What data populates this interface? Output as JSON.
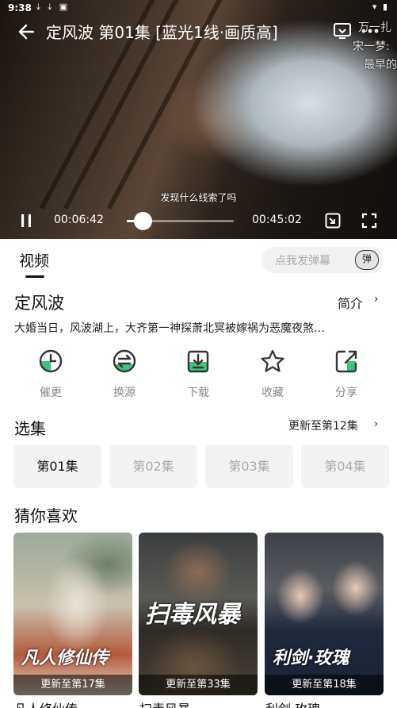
{
  "status": {
    "time": "9:38",
    "icons": "⤓ ⤓ ▣",
    "right": "▾ ▮"
  },
  "player": {
    "title": "定风波 第01集 [蓝光1线·画质高]",
    "danmaku": [
      "万一扎",
      "宋一梦:",
      "最早的"
    ],
    "subtitle": "发现什么线索了吗",
    "current_time": "00:06:42",
    "total_time": "00:45:02",
    "progress": 0.149
  },
  "tabs": {
    "video": "视频"
  },
  "danmaku_input": {
    "placeholder": "点我发弹幕",
    "button": "弹"
  },
  "show": {
    "title": "定风波",
    "intro_link": "简介",
    "synopsis": "大婚当日，风波湖上，大齐第一神探萧北冥被嫁祸为恶魔夜煞…"
  },
  "actions": [
    {
      "label": "催更",
      "icon": "clock-icon"
    },
    {
      "label": "换源",
      "icon": "switch-source-icon"
    },
    {
      "label": "下载",
      "icon": "download-icon"
    },
    {
      "label": "收藏",
      "icon": "star-icon"
    },
    {
      "label": "分享",
      "icon": "share-icon"
    }
  ],
  "episodes": {
    "title": "选集",
    "update_text": "更新至第12集",
    "items": [
      "第01集",
      "第02集",
      "第03集",
      "第04集"
    ]
  },
  "recommend": {
    "title": "猜你喜欢",
    "items": [
      {
        "name": "凡人修仙传",
        "badge": "更新至第17集",
        "art_text": "凡人修仙传"
      },
      {
        "name": "扫毒风暴",
        "badge": "更新至第33集",
        "art_text": "扫毒风暴"
      },
      {
        "name": "利剑·玫瑰",
        "badge": "更新至第18集",
        "art_text": "利剑·玫瑰"
      }
    ]
  },
  "colors": {
    "accent_green": "#3cc47c",
    "player_bg": "#0b0b0b"
  }
}
